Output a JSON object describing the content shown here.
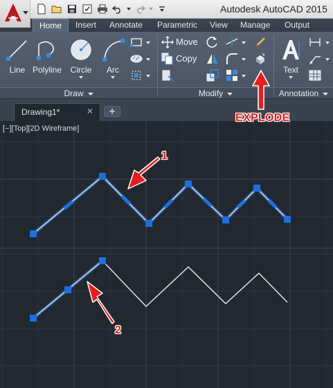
{
  "app": {
    "title": "Autodesk AutoCAD 2015",
    "accent": "#c0121b"
  },
  "ribbon": {
    "tabs": [
      "Home",
      "Insert",
      "Annotate",
      "Parametric",
      "View",
      "Manage",
      "Output"
    ],
    "active_tab": "Home",
    "draw": {
      "title": "Draw",
      "tools": [
        "Line",
        "Polyline",
        "Circle",
        "Arc"
      ]
    },
    "modify": {
      "title": "Modify",
      "move": "Move",
      "copy": "Copy"
    },
    "annotation": {
      "title": "Annotation",
      "text": "Text"
    }
  },
  "document": {
    "tab_name": "Drawing1*",
    "viewport_label": "[−][Top][2D Wireframe]"
  },
  "annotations": {
    "explode": "EXPLODE",
    "marker_1": "1",
    "marker_2": "2",
    "color": "#e41e1e"
  },
  "icons": [
    "autocad-logo-icon",
    "new-file-icon",
    "open-icon",
    "save-icon",
    "saveas-icon",
    "print-icon",
    "undo-icon",
    "redo-icon",
    "explode-icon",
    "text-icon"
  ]
}
